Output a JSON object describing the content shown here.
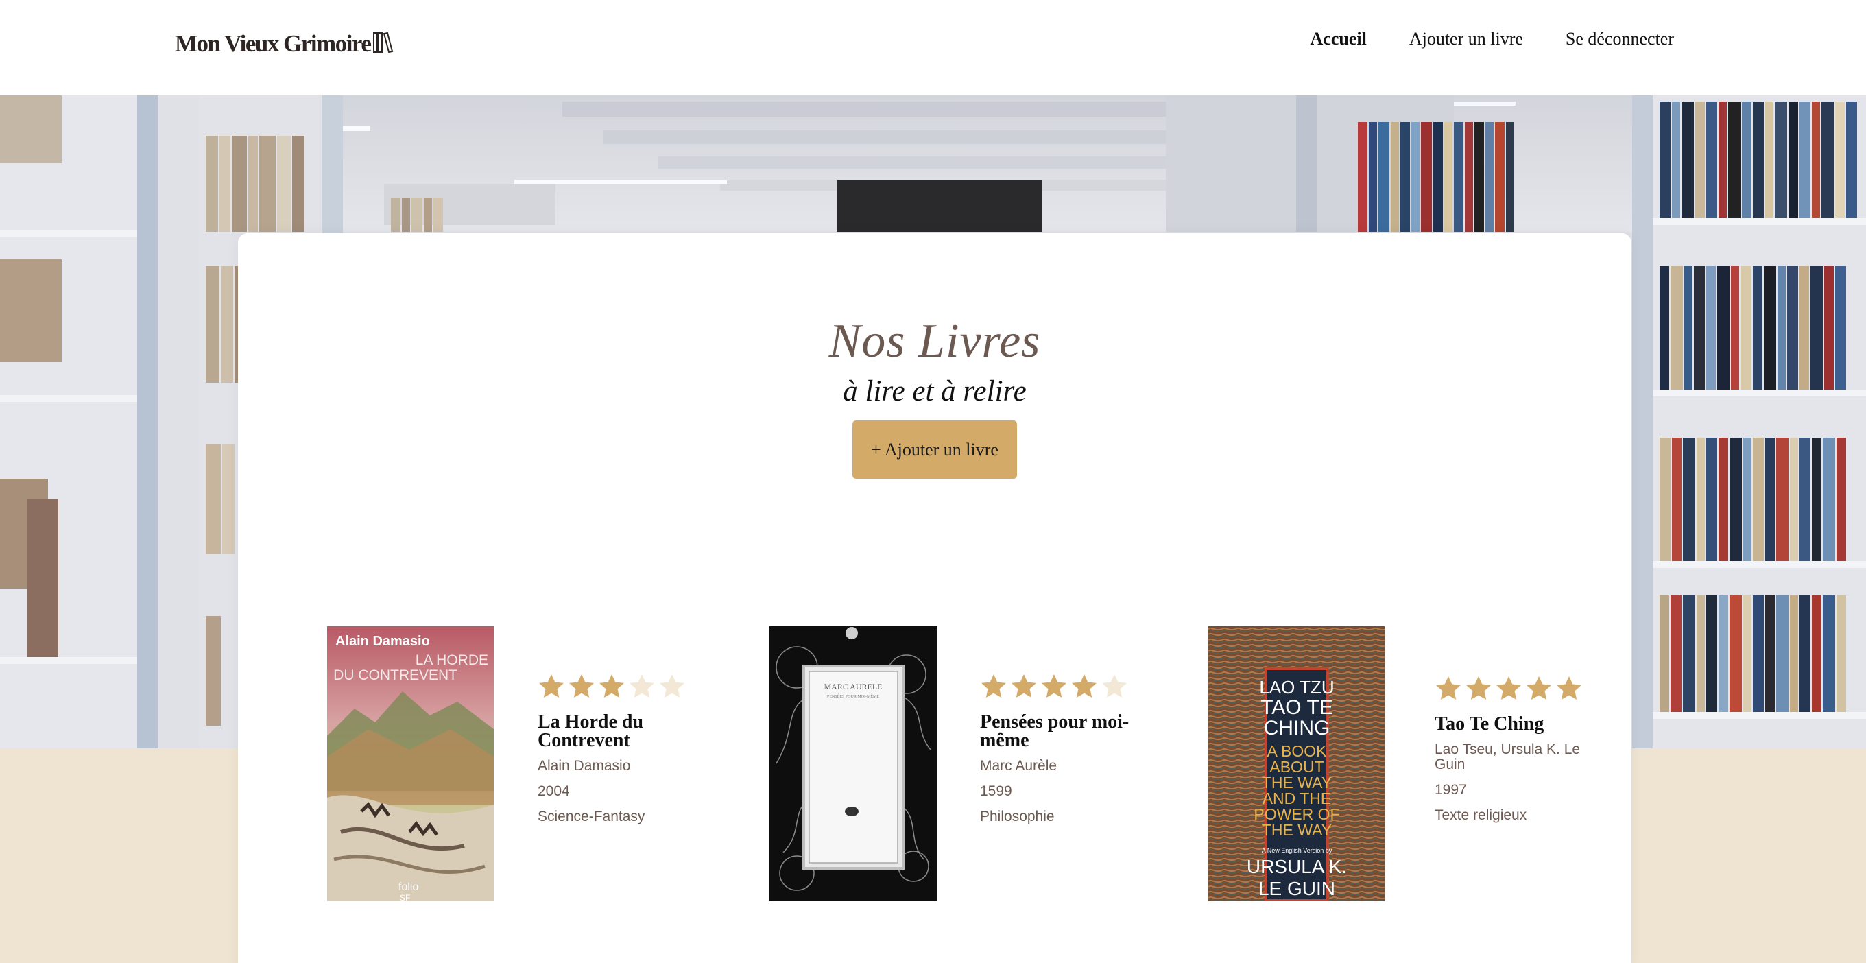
{
  "header": {
    "logo_text": "Mon Vieux Grimoire",
    "nav": [
      {
        "label": "Accueil",
        "active": true
      },
      {
        "label": "Ajouter un livre",
        "active": false
      },
      {
        "label": "Se déconnecter",
        "active": false
      }
    ]
  },
  "main": {
    "title": "Nos Livres",
    "subtitle": "à lire et à relire",
    "add_button_label": "+ Ajouter un livre"
  },
  "books": [
    {
      "title": "La Horde du Contrevent",
      "author": "Alain Damasio",
      "year": "2004",
      "genre": "Science-Fantasy",
      "rating": 3,
      "max_rating": 5,
      "cover_texts": [
        "Alain Damasio",
        "LA HORDE",
        "DU CONTREVENT",
        "folio",
        "SF"
      ]
    },
    {
      "title": "Pensées pour moi-même",
      "author": "Marc Aurèle",
      "year": "1599",
      "genre": "Philosophie",
      "rating": 4,
      "max_rating": 5,
      "cover_texts": [
        "MARC AURELE",
        "PENSÉES POUR MOI-MÊME"
      ]
    },
    {
      "title": "Tao Te Ching",
      "author": "Lao Tseu, Ursula K. Le Guin",
      "year": "1997",
      "genre": "Texte religieux",
      "rating": 5,
      "max_rating": 5,
      "cover_texts": [
        "LAO TZU",
        "TAO TE",
        "CHING",
        "A BOOK",
        "ABOUT",
        "THE WAY",
        "AND THE",
        "POWER OF",
        "THE WAY",
        "A New English Version by",
        "URSULA K.",
        "LE GUIN"
      ]
    }
  ],
  "colors": {
    "accent": "#d3aa68",
    "star_filled": "#d3aa68",
    "star_empty": "#f3e8d6",
    "title": "#6c5a52",
    "meta_text": "#6c5a52",
    "beige_band": "#efe3d1"
  },
  "icons": {
    "logo": "books-icon",
    "rating": "star-icon"
  }
}
